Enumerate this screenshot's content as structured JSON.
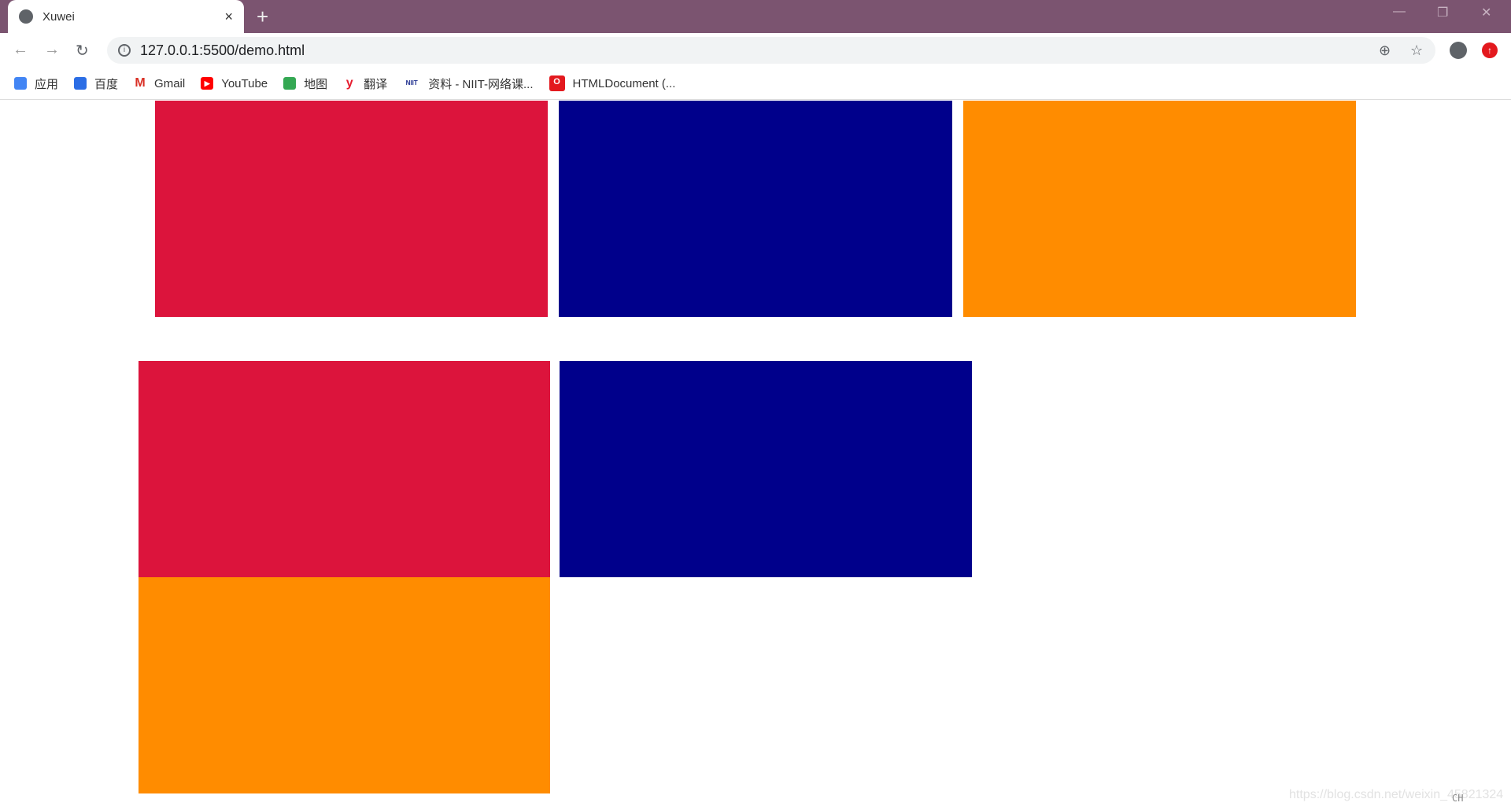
{
  "browser": {
    "tab_title": "Xuwei",
    "url": "127.0.0.1:5500/demo.html",
    "new_tab": "+",
    "close": "×"
  },
  "bookmarks": [
    {
      "label": "应用",
      "icon": "apps-grid-icon",
      "color": "#4285f4"
    },
    {
      "label": "百度",
      "icon": "baidu-paw-icon",
      "color": "#2b6de5"
    },
    {
      "label": "Gmail",
      "icon": "gmail-icon",
      "color": "#d93025"
    },
    {
      "label": "YouTube",
      "icon": "youtube-icon",
      "color": "#ff0000"
    },
    {
      "label": "地图",
      "icon": "maps-pin-icon",
      "color": "#34a853"
    },
    {
      "label": "翻译",
      "icon": "youdao-icon",
      "color": "#e61c2e"
    },
    {
      "label": "资料 - NIIT-网络课...",
      "icon": "niit-icon",
      "color": "#1a2b8c"
    },
    {
      "label": "HTMLDocument (...",
      "icon": "oracle-icon",
      "color": "#e3191e"
    }
  ],
  "boxes": {
    "row1": [
      "#dc143c",
      "#00008b",
      "#ff8c00"
    ],
    "row2": [
      "#dc143c",
      "#00008b",
      "#ff8c00"
    ]
  },
  "watermark": "https://blog.csdn.net/weixin_45821324",
  "ime": "CH"
}
